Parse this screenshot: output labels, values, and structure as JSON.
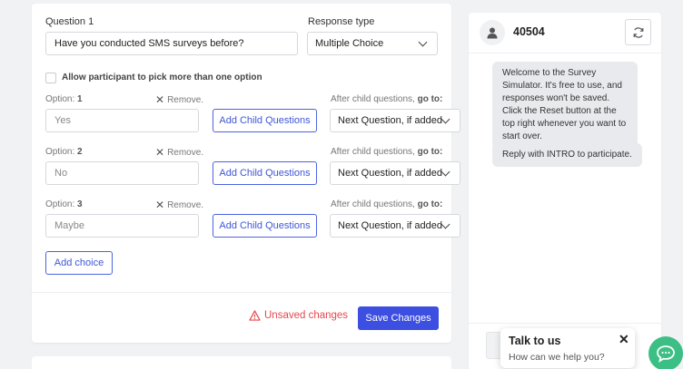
{
  "question": {
    "label": "Question 1",
    "value": "Have you conducted SMS surveys before?",
    "response_type_label": "Response type",
    "response_type_value": "Multiple Choice"
  },
  "multi_select": {
    "label": "Allow participant to pick more than one option",
    "checked": false
  },
  "options": [
    {
      "label_prefix": "Option:",
      "number": "1",
      "remove": "Remove.",
      "placeholder": "Yes",
      "child_button": "Add Child Questions",
      "goto_label": "After child questions,",
      "goto_bold": "go to:",
      "goto_value": "Next Question, if added"
    },
    {
      "label_prefix": "Option:",
      "number": "2",
      "remove": "Remove.",
      "placeholder": "No",
      "child_button": "Add Child Questions",
      "goto_label": "After child questions,",
      "goto_bold": "go to:",
      "goto_value": "Next Question, if added"
    },
    {
      "label_prefix": "Option:",
      "number": "3",
      "remove": "Remove.",
      "placeholder": "Maybe",
      "child_button": "Add Child Questions",
      "goto_label": "After child questions,",
      "goto_bold": "go to:",
      "goto_value": "Next Question, if added"
    }
  ],
  "add_choice_label": "Add choice",
  "footer": {
    "unsaved_text": "Unsaved changes",
    "save_label": "Save Changes"
  },
  "simulator": {
    "phone_number": "40504",
    "messages": [
      "Welcome to the Survey Simulator. It's free to use, and responses won't be saved. Click the Reset button at the top right whenever you want to start over.",
      "Reply with INTRO to participate."
    ]
  },
  "chat_widget": {
    "title": "Talk to us",
    "subtitle": "How can we help you?"
  },
  "colors": {
    "primary": "#3c4fe0",
    "warning": "#e5484d",
    "chat_green": "#3bbf84"
  },
  "icons": [
    "user-icon",
    "refresh-icon",
    "close-icon",
    "warning-icon",
    "chevron-down-icon",
    "chat-icon"
  ]
}
